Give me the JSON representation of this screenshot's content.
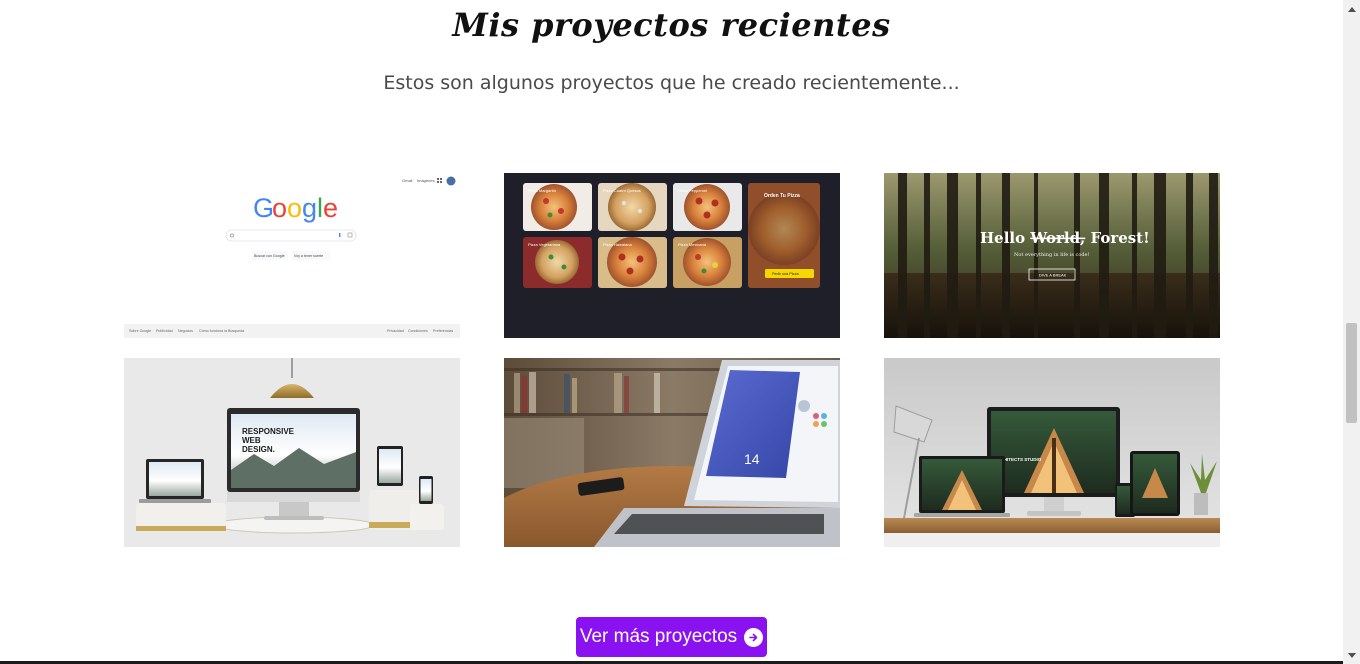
{
  "section": {
    "title": "Mis proyectos recientes",
    "subtitle": "Estos son algunos proyectos que he creado recientemente..."
  },
  "projects": [
    {
      "name": "Google clone",
      "google_logo": [
        "G",
        "o",
        "o",
        "g",
        "l",
        "e"
      ],
      "logo_colors": [
        "#4285F4",
        "#EA4335",
        "#FBBC05",
        "#4285F4",
        "#34A853",
        "#EA4335"
      ],
      "top_links": [
        "Gmail",
        "Imágenes"
      ],
      "buttons": [
        "Buscar con Google",
        "Voy a tener suerte"
      ],
      "footer_left": [
        "Sobre Google",
        "Publicidad",
        "Negocios",
        "Cómo funciona la Búsqueda"
      ],
      "footer_right": [
        "Privacidad",
        "Condiciones",
        "Preferencias"
      ]
    },
    {
      "name": "Pizza landing",
      "tiles": [
        "Pizza Margarita",
        "Pizza Cuatro Quesos",
        "Pizza Pepperoni",
        "Pizza Vegetariana",
        "Pizza Hawaiana",
        "Pizza Mexicana"
      ],
      "order_title": "Orden Tu Pizza",
      "order_button": "Pedir una Pizza",
      "accent": "#f6d800"
    },
    {
      "name": "Forest landing",
      "headline_prefix": "Hello ",
      "headline_struck": "World,",
      "headline_suffix": " Forest!",
      "tagline": "Not everything in life is code!",
      "cta": "DIVE A BREAK"
    },
    {
      "name": "Responsive web design mockup",
      "screen_text": [
        "RESPONSIVE",
        "WEB",
        "DESIGN."
      ]
    },
    {
      "name": "Laptop on desk",
      "screen_number": "14"
    },
    {
      "name": "Architecture studio mockup",
      "screen_text": "ARCHITECTS STUDIO"
    }
  ],
  "cta_button": {
    "label": "Ver más proyectos",
    "icon": "arrow-right-circle-icon",
    "color": "#8a12f0"
  },
  "scrollbar": {
    "position_fraction": 0.52
  }
}
